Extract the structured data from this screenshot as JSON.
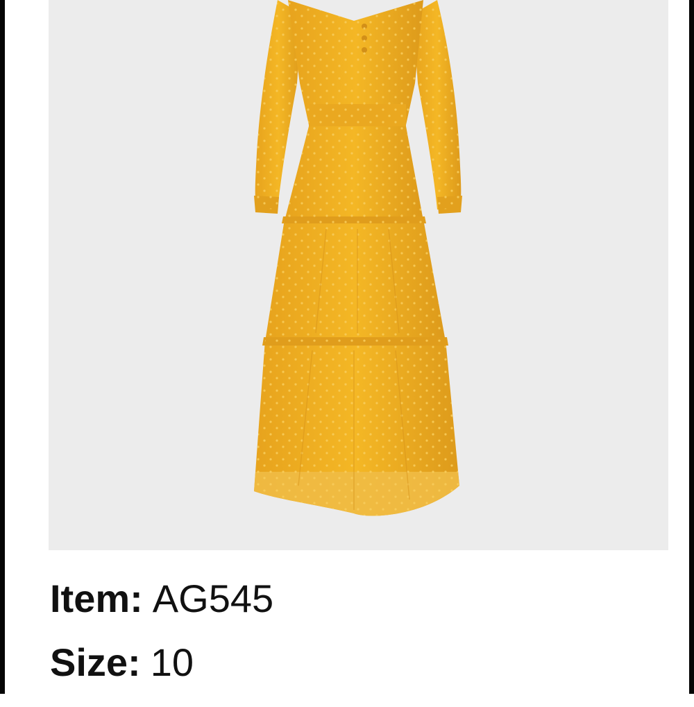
{
  "product": {
    "image_subject": "yellow-tiered-midi-dress",
    "colors": {
      "dress": "#f2b221",
      "dress_shadow": "#d9951a",
      "background": "#ececec"
    }
  },
  "details": {
    "item_label": "Item:",
    "item_value": "AG545",
    "size_label": "Size:",
    "size_value": "10"
  }
}
